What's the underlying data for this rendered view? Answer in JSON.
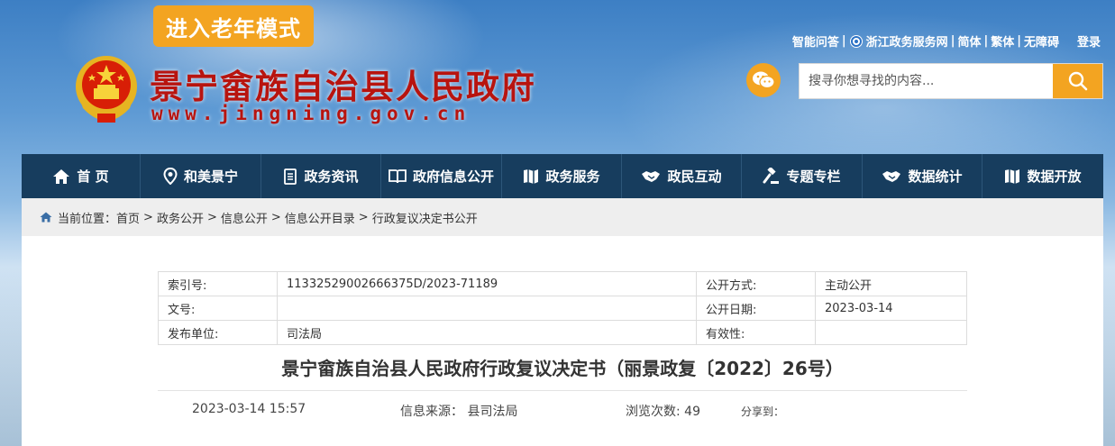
{
  "header": {
    "elder_mode": "进入老年模式",
    "site_title": "景宁畲族自治县人民政府",
    "site_url": "www.jingning.gov.cn",
    "top_links": {
      "smart_qa": "智能问答",
      "zj_service": "浙江政务服务网",
      "simplified": "简体",
      "traditional": "繁体",
      "accessibility": "无障碍",
      "login": "登录"
    },
    "search": {
      "placeholder": "搜寻你想寻找的内容..."
    }
  },
  "nav": [
    {
      "label": "首 页",
      "icon": "home-icon"
    },
    {
      "label": "和美景宁",
      "icon": "location-icon"
    },
    {
      "label": "政务资讯",
      "icon": "document-icon"
    },
    {
      "label": "政府信息公开",
      "icon": "book-icon"
    },
    {
      "label": "政务服务",
      "icon": "map-icon"
    },
    {
      "label": "政民互动",
      "icon": "handshake-icon"
    },
    {
      "label": "专题专栏",
      "icon": "gavel-icon"
    },
    {
      "label": "数据统计",
      "icon": "handshake-icon"
    },
    {
      "label": "数据开放",
      "icon": "map-icon"
    }
  ],
  "breadcrumb": {
    "prefix": "当前位置：",
    "items": [
      "首页",
      "政务公开",
      "信息公开",
      "信息公开目录",
      "行政复议决定书公开"
    ]
  },
  "meta": {
    "index_label": "索引号:",
    "index_value": "11332529002666375D/2023-71189",
    "open_method_label": "公开方式:",
    "open_method_value": "主动公开",
    "doc_no_label": "文号:",
    "doc_no_value": "",
    "open_date_label": "公开日期:",
    "open_date_value": "2023-03-14",
    "issuer_label": "发布单位:",
    "issuer_value": "司法局",
    "validity_label": "有效性:",
    "validity_value": ""
  },
  "article": {
    "title": "景宁畲族自治县人民政府行政复议决定书（丽景政复〔2022〕26号）",
    "datetime": "2023-03-14 15:57",
    "source_label": "信息来源：",
    "source_value": "县司法局",
    "views_label": "浏览次数:",
    "views_value": "49",
    "share_label": "分享到："
  },
  "colors": {
    "nav_bg": "#173d5e",
    "accent_orange": "#f3a421",
    "title_red": "#b8140f"
  }
}
